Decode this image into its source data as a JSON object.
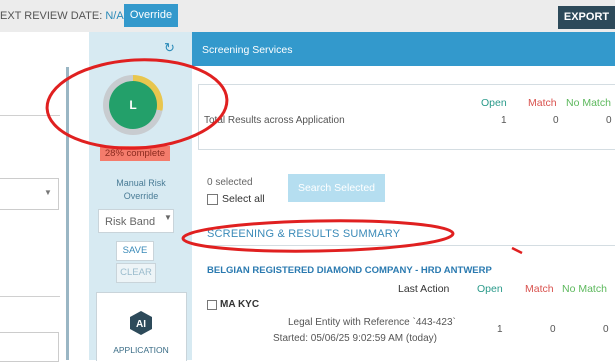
{
  "topbar": {
    "review_label": "EXT REVIEW DATE:",
    "review_value": "N/A",
    "override_label": "Override",
    "export_label": "EXPORT"
  },
  "side": {
    "refresh_icon": "refresh-icon",
    "avatar_initial": "L",
    "progress_fraction": 0.28,
    "complete_text": "28% complete",
    "risk_label_line1": "Manual Risk",
    "risk_label_line2": "Override",
    "risk_band_label": "Risk Band",
    "save_label": "SAVE",
    "clear_label": "CLEAR",
    "ai_icon_text": "AI",
    "app_label": "APPLICATION"
  },
  "screening": {
    "title": "Screening Services",
    "columns": {
      "open": "Open",
      "match": "Match",
      "no_match": "No Match"
    },
    "totals": {
      "label": "Total Results across Application",
      "open": "1",
      "match": "0",
      "no_match": "0"
    },
    "selected_count": "0 selected",
    "select_all_label": "Select all",
    "search_selected_label": "Search Selected",
    "summary_title": "SCREENING & RESULTS SUMMARY",
    "company": {
      "name": "BELGIAN REGISTERED DIAMOND COMPANY - HRD ANTWERP",
      "last_action_label": "Last Action",
      "kyc_label": "MA KYC",
      "entity_desc": "Legal Entity with Reference `443-423`",
      "started": "Started: 05/06/25 9:02:59 AM (today)",
      "open": "1",
      "match": "0",
      "no_match": "0"
    }
  },
  "colors": {
    "accent": "#3399cc",
    "export_bg": "#2d4a5a",
    "avatar_green": "#23a06a",
    "progress_yellow": "#e8c64e",
    "badge_red": "#f47c6c",
    "open_green": "#2a9a8a",
    "match_red": "#d9534f",
    "no_match_green": "#5cb85c",
    "annotation_red": "#e02020"
  }
}
